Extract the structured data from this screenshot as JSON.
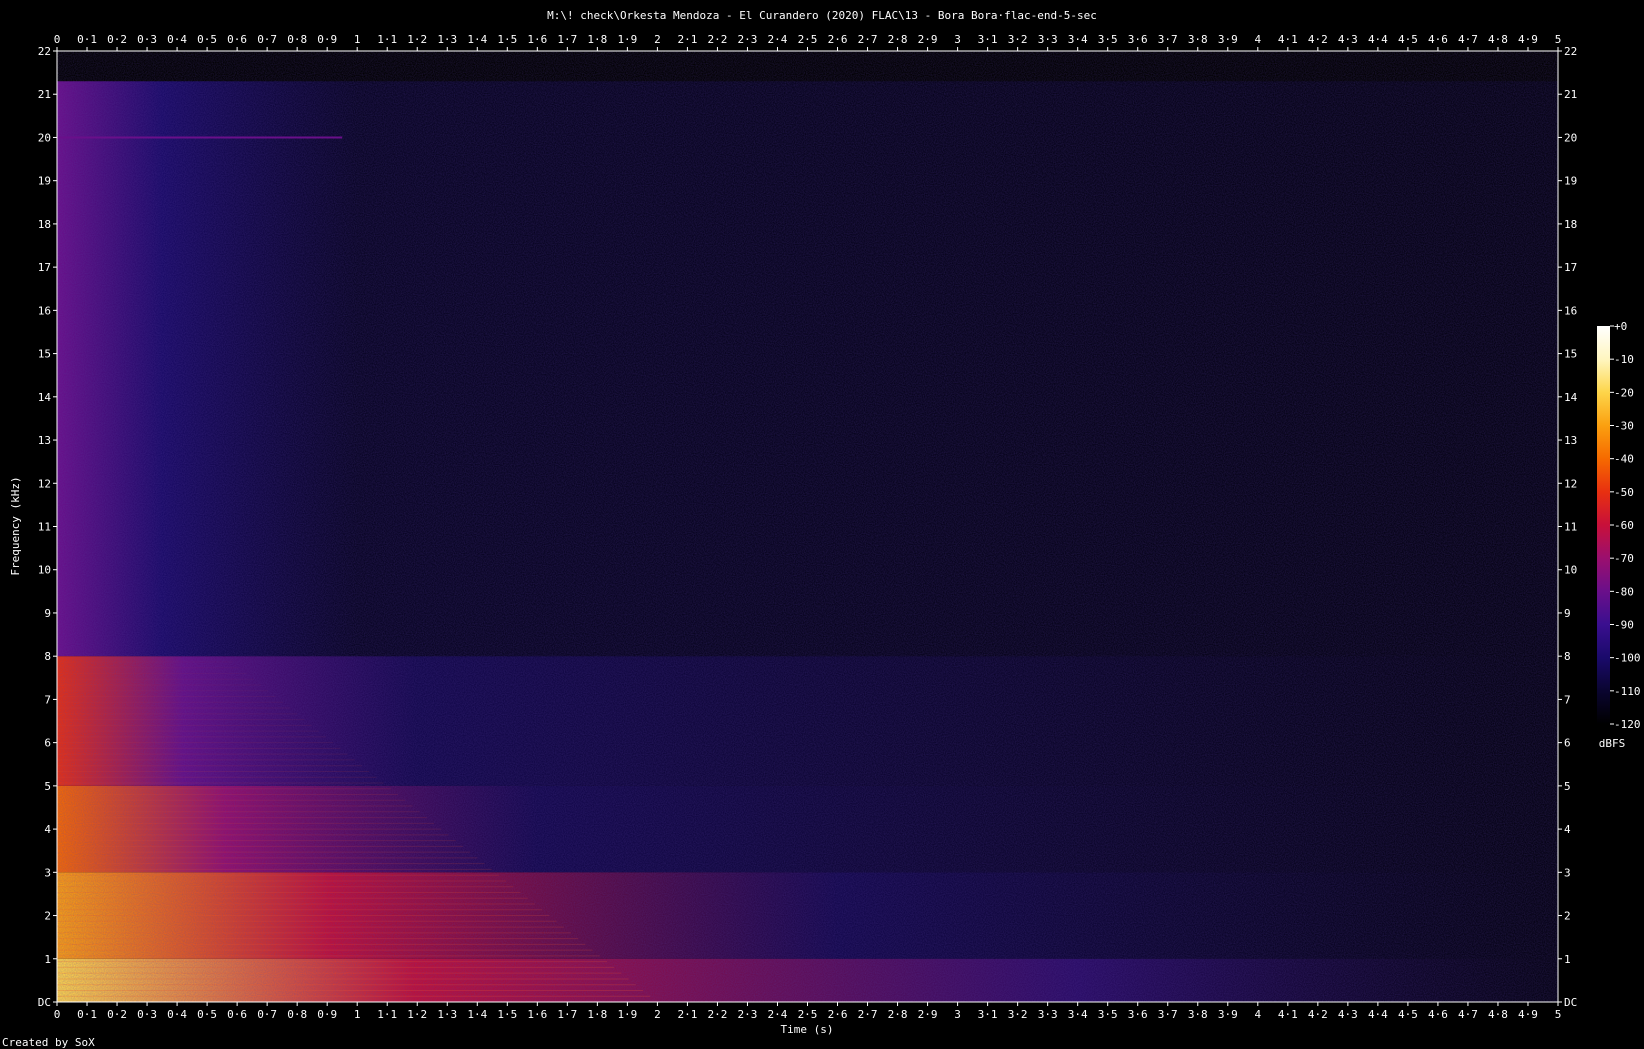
{
  "chart_data": {
    "type": "heatmap",
    "title": "M:\\! check\\Orkesta Mendoza - El Curandero (2020) FLAC\\13 - Bora Bora·flac-end-5-sec",
    "xlabel": "Time (s)",
    "ylabel": "Frequency (kHz)",
    "xlim": [
      0,
      5
    ],
    "ylim": [
      0,
      22
    ],
    "x_ticks": [
      "0",
      "0·1",
      "0·2",
      "0·3",
      "0·4",
      "0·5",
      "0·6",
      "0·7",
      "0·8",
      "0·9",
      "1",
      "1·1",
      "1·2",
      "1·3",
      "1·4",
      "1·5",
      "1·6",
      "1·7",
      "1·8",
      "1·9",
      "2",
      "2·1",
      "2·2",
      "2·3",
      "2·4",
      "2·5",
      "2·6",
      "2·7",
      "2·8",
      "2·9",
      "3",
      "3·1",
      "3·2",
      "3·3",
      "3·4",
      "3·5",
      "3·6",
      "3·7",
      "3·8",
      "3·9",
      "4",
      "4·1",
      "4·2",
      "4·3",
      "4·4",
      "4·5",
      "4·6",
      "4·7",
      "4·8",
      "4·9",
      "5"
    ],
    "y_ticks": [
      "DC",
      "1",
      "2",
      "3",
      "4",
      "5",
      "6",
      "7",
      "8",
      "9",
      "10",
      "11",
      "12",
      "13",
      "14",
      "15",
      "16",
      "17",
      "18",
      "19",
      "20",
      "21",
      "22"
    ],
    "colorbar": {
      "label": "dBFS",
      "range": [
        -120,
        0
      ],
      "ticks": [
        "+0",
        "-10",
        "-20",
        "-30",
        "-40",
        "-50",
        "-60",
        "-70",
        "-80",
        "-90",
        "-100",
        "-110",
        "-120"
      ],
      "colors": [
        "#000000",
        "#0a0530",
        "#1a0a6b",
        "#3a0f8f",
        "#6a0f8a",
        "#9b0f6e",
        "#c8103a",
        "#e83010",
        "#f66a00",
        "#fba010",
        "#fdd54a",
        "#fff6c0",
        "#ffffff"
      ]
    },
    "energy_bands": [
      {
        "f_low": 0,
        "f_high": 1,
        "level_db_start": -25,
        "level_db_end": -90,
        "fade_end_s": 3.4
      },
      {
        "f_low": 1,
        "f_high": 3,
        "level_db_start": -30,
        "level_db_end": -100,
        "fade_end_s": 2.6
      },
      {
        "f_low": 3,
        "f_high": 5,
        "level_db_start": -40,
        "level_db_end": -100,
        "fade_end_s": 1.6
      },
      {
        "f_low": 5,
        "f_high": 8,
        "level_db_start": -55,
        "level_db_end": -105,
        "fade_end_s": 1.2
      },
      {
        "f_low": 8,
        "f_high": 21.3,
        "level_db_start": -85,
        "level_db_end": -110,
        "fade_end_s": 1.0
      }
    ],
    "tone_line": {
      "freq_khz": 20,
      "t_start": 0,
      "t_end": 0.95,
      "level_db": -80
    },
    "cutoff_khz": 21.3
  },
  "footer": "Created by SoX"
}
